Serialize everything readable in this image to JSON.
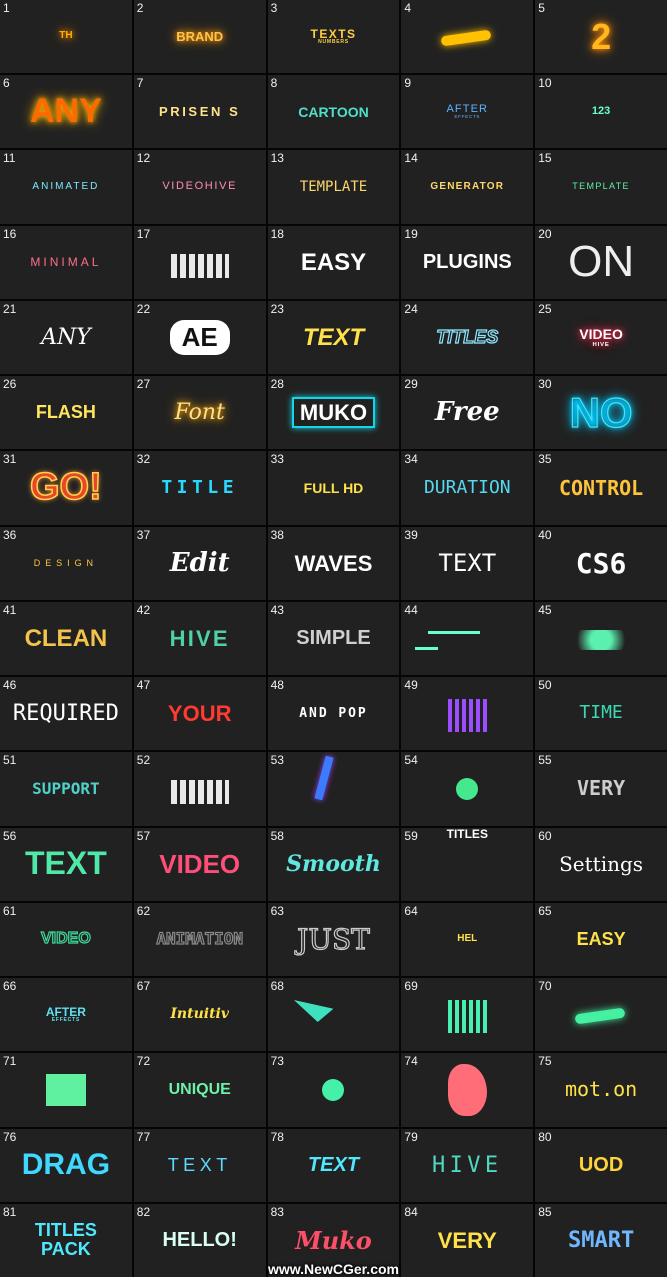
{
  "watermark": "www.NewCGer.com",
  "cells": [
    {
      "n": "1",
      "t": "TH",
      "s": "",
      "c": "#ffb000",
      "sz": 10,
      "f": "sans",
      "w": "bold",
      "g": "#ff8800"
    },
    {
      "n": "2",
      "t": "BRAND",
      "s": "",
      "c": "#ffc34d",
      "sz": 13,
      "f": "sans",
      "w": "bold",
      "g": "#ff9a00"
    },
    {
      "n": "3",
      "t": "TEXTS",
      "s": "NUMBERS",
      "c": "#ffcf40",
      "sz": 12,
      "f": "sans",
      "w": "bold",
      "ls": "0.12em"
    },
    {
      "n": "4",
      "t": "",
      "c": "#ffc100",
      "shape": "stroke"
    },
    {
      "n": "5",
      "t": "2",
      "s": "",
      "c": "#ffb81e",
      "sz": 36,
      "f": "sans",
      "w": "bold",
      "g": "#ff8c00"
    },
    {
      "n": "6",
      "t": "ANY",
      "s": "",
      "c": "#ff6a00",
      "sz": 34,
      "f": "sans",
      "w": "bold",
      "g": "#ffb300"
    },
    {
      "n": "7",
      "t": "PRISEN S",
      "s": "",
      "c": "#ffe28a",
      "sz": 13,
      "f": "sans",
      "w": "bold",
      "ls": "0.2em"
    },
    {
      "n": "8",
      "t": "CARTOON",
      "s": "",
      "c": "#4fe0c8",
      "sz": 14,
      "f": "sans",
      "w": "bold"
    },
    {
      "n": "9",
      "t": "AFTER",
      "s": "EFFECTS",
      "c": "#5fb3ff",
      "sz": 11,
      "f": "sans",
      "w": "normal",
      "ls": "0.1em"
    },
    {
      "n": "10",
      "t": "123",
      "s": "",
      "c": "#66ffd0",
      "sz": 11,
      "f": "sans",
      "w": "bold"
    },
    {
      "n": "11",
      "t": "ANIMATED",
      "s": "",
      "c": "#7ee8ff",
      "sz": 10,
      "f": "sans",
      "w": "normal",
      "ls": "0.2em"
    },
    {
      "n": "12",
      "t": "VIDEOHIVE",
      "s": "",
      "c": "#ff8fb0",
      "sz": 11,
      "f": "sans",
      "w": "normal",
      "ls": "0.15em"
    },
    {
      "n": "13",
      "t": "TEMPLATE",
      "s": "",
      "c": "#ffd86b",
      "sz": 14,
      "f": "mono",
      "w": "normal"
    },
    {
      "n": "14",
      "t": "GENERATOR",
      "s": "",
      "c": "#ffd86b",
      "sz": 10,
      "f": "sans",
      "w": "bold",
      "ls": "0.12em"
    },
    {
      "n": "15",
      "t": "TEMPLATE",
      "s": "",
      "c": "#62f2a8",
      "sz": 9,
      "f": "sans",
      "w": "normal",
      "ls": "0.15em"
    },
    {
      "n": "16",
      "t": "MINIMAL",
      "s": "",
      "c": "#ff6e8a",
      "sz": 12,
      "f": "sans",
      "w": "normal",
      "ls": "0.25em"
    },
    {
      "n": "17",
      "t": "",
      "s": "",
      "c": "#ffffff",
      "shape": "glitch"
    },
    {
      "n": "18",
      "t": "EASY",
      "s": "",
      "c": "#ffffff",
      "sz": 24,
      "f": "sans",
      "w": "bold"
    },
    {
      "n": "19",
      "t": "PLUGINS",
      "s": "",
      "c": "#ffffff",
      "sz": 20,
      "f": "sans",
      "w": "bold"
    },
    {
      "n": "20",
      "t": "ON",
      "s": "",
      "c": "#eeeeee",
      "sz": 44,
      "f": "sans",
      "w": "normal"
    },
    {
      "n": "21",
      "t": "ANY",
      "s": "",
      "c": "#ffffff",
      "sz": 22,
      "f": "serif",
      "w": "normal",
      "it": 1
    },
    {
      "n": "22",
      "t": "AE",
      "s": "",
      "c": "#ffffff",
      "sz": 26,
      "f": "sans",
      "w": "bold",
      "badge": 1
    },
    {
      "n": "23",
      "t": "TEXT",
      "s": "",
      "c": "#ffe14a",
      "sz": 24,
      "f": "sans",
      "w": "bold",
      "it": 1
    },
    {
      "n": "24",
      "t": "TITLES",
      "s": "",
      "c": "#8de7ff",
      "sz": 18,
      "f": "sans",
      "w": "bold",
      "it": 1,
      "outline": 1
    },
    {
      "n": "25",
      "t": "VIDEO",
      "s": "HIVE",
      "c": "#ffffff",
      "sz": 14,
      "f": "sans",
      "w": "bold",
      "g": "#ff2d55"
    },
    {
      "n": "26",
      "t": "FLASH",
      "s": "",
      "c": "#ffe65c",
      "sz": 18,
      "f": "sans",
      "w": "bold"
    },
    {
      "n": "27",
      "t": "Font",
      "s": "",
      "c": "#ffde8a",
      "sz": 22,
      "f": "serif",
      "w": "normal",
      "it": 1,
      "g": "#ffaa00"
    },
    {
      "n": "28",
      "t": "MUKO",
      "s": "",
      "c": "#ffffff",
      "sz": 22,
      "f": "sans",
      "w": "bold",
      "box": "#14d6e8"
    },
    {
      "n": "29",
      "t": "Free",
      "s": "",
      "c": "#ffffff",
      "sz": 26,
      "f": "serif",
      "w": "bold",
      "it": 1
    },
    {
      "n": "30",
      "t": "NO",
      "s": "",
      "c": "#43e6f0",
      "sz": 42,
      "f": "sans",
      "w": "bold",
      "outline": 1,
      "g": "#00c8ff"
    },
    {
      "n": "31",
      "t": "GO!",
      "s": "",
      "c": "#ffd24a",
      "sz": 38,
      "f": "sans",
      "w": "bold",
      "bulb": 1
    },
    {
      "n": "32",
      "t": "TITLE",
      "s": "",
      "c": "#29d8ff",
      "sz": 18,
      "f": "mono",
      "w": "bold",
      "ls": "0.25em"
    },
    {
      "n": "33",
      "t": "FULL HD",
      "s": "",
      "c": "#ffe24a",
      "sz": 14,
      "f": "sans",
      "w": "bold"
    },
    {
      "n": "34",
      "t": "DURATION",
      "s": "",
      "c": "#55d8f0",
      "sz": 18,
      "f": "mono",
      "w": "normal"
    },
    {
      "n": "35",
      "t": "CONTROL",
      "s": "",
      "c": "#ffc23b",
      "sz": 20,
      "f": "mono",
      "w": "bold"
    },
    {
      "n": "36",
      "t": "DESIGN",
      "s": "",
      "c": "#ffc640",
      "sz": 9,
      "f": "sans",
      "w": "normal",
      "ls": "0.55em"
    },
    {
      "n": "37",
      "t": "Edit",
      "s": "",
      "c": "#ffffff",
      "sz": 26,
      "f": "serif",
      "w": "bold",
      "it": 1
    },
    {
      "n": "38",
      "t": "WAVES",
      "s": "",
      "c": "#ffffff",
      "sz": 22,
      "f": "sans",
      "w": "bold"
    },
    {
      "n": "39",
      "t": "TEXT",
      "s": "",
      "c": "#ffffff",
      "sz": 24,
      "f": "mono",
      "w": "normal"
    },
    {
      "n": "40",
      "t": "CS6",
      "s": "",
      "c": "#ffffff",
      "sz": 28,
      "f": "mono",
      "w": "bold"
    },
    {
      "n": "41",
      "t": "CLEAN",
      "s": "",
      "c": "#f4c34a",
      "sz": 24,
      "f": "sans",
      "w": "bold"
    },
    {
      "n": "42",
      "t": "HIVE",
      "s": "",
      "c": "#4fd0a8",
      "sz": 22,
      "f": "sans",
      "w": "bold",
      "ls": "0.1em"
    },
    {
      "n": "43",
      "t": "SIMPLE",
      "s": "",
      "c": "#cfcfcf",
      "sz": 20,
      "f": "sans",
      "w": "bold"
    },
    {
      "n": "44",
      "t": "",
      "s": "",
      "c": "#66ffd0",
      "shape": "dashes"
    },
    {
      "n": "45",
      "t": "",
      "s": "",
      "c": "#5bf0b0",
      "shape": "splash"
    },
    {
      "n": "46",
      "t": "REQUIRED",
      "s": "",
      "c": "#ffffff",
      "sz": 22,
      "f": "mono",
      "w": "normal"
    },
    {
      "n": "47",
      "t": "YOUR",
      "s": "",
      "c": "#ff3b30",
      "sz": 22,
      "f": "sans",
      "w": "bold"
    },
    {
      "n": "48",
      "t": "AND POP",
      "s": "",
      "c": "#ffffff",
      "sz": 13,
      "f": "mono",
      "w": "bold",
      "ls": "0.15em"
    },
    {
      "n": "49",
      "t": "",
      "s": "",
      "c": "#9b4dff",
      "shape": "bars"
    },
    {
      "n": "50",
      "t": "TIME",
      "s": "",
      "c": "#3cd8b0",
      "sz": 18,
      "f": "mono",
      "w": "normal"
    },
    {
      "n": "51",
      "t": "SUPPORT",
      "s": "",
      "c": "#4fd0c8",
      "sz": 16,
      "f": "mono",
      "w": "bold"
    },
    {
      "n": "52",
      "t": "",
      "s": "",
      "c": "#ffffff",
      "shape": "glitch"
    },
    {
      "n": "53",
      "t": "",
      "s": "",
      "c": "#3a7bff",
      "shape": "streak"
    },
    {
      "n": "54",
      "t": "",
      "s": "",
      "c": "#45e88c",
      "shape": "dot"
    },
    {
      "n": "55",
      "t": "VERY",
      "s": "",
      "c": "#cccccc",
      "sz": 20,
      "f": "mono",
      "w": "bold"
    },
    {
      "n": "56",
      "t": "TEXT",
      "s": "",
      "c": "#4fe8a8",
      "sz": 32,
      "f": "sans",
      "w": "bold"
    },
    {
      "n": "57",
      "t": "VIDEO",
      "s": "",
      "c": "#ff4f78",
      "sz": 26,
      "f": "sans",
      "w": "bold"
    },
    {
      "n": "58",
      "t": "Smooth",
      "s": "",
      "c": "#5fe8e0",
      "sz": 22,
      "f": "serif",
      "w": "bold",
      "it": 1
    },
    {
      "n": "59",
      "t": "TITLES",
      "s": "",
      "c": "#ffffff",
      "sz": 12,
      "f": "sans",
      "w": "bold",
      "top": 1
    },
    {
      "n": "60",
      "t": "Settings",
      "s": "",
      "c": "#ffffff",
      "sz": 20,
      "f": "serif",
      "w": "normal"
    },
    {
      "n": "61",
      "t": "VIDEO",
      "s": "",
      "c": "#3fd89a",
      "sz": 16,
      "f": "sans",
      "w": "bold",
      "outline": 1
    },
    {
      "n": "62",
      "t": "ANIMATION",
      "s": "",
      "c": "#888888",
      "sz": 16,
      "f": "mono",
      "w": "bold",
      "outline": 1
    },
    {
      "n": "63",
      "t": "JUST",
      "s": "",
      "c": "#cccccc",
      "sz": 28,
      "f": "serif",
      "w": "normal",
      "outline": 1
    },
    {
      "n": "64",
      "t": "HEL",
      "s": "",
      "c": "#ffe24a",
      "sz": 10,
      "f": "sans",
      "w": "bold"
    },
    {
      "n": "65",
      "t": "EASY",
      "s": "",
      "c": "#ffe24a",
      "sz": 18,
      "f": "sans",
      "w": "bold"
    },
    {
      "n": "66",
      "t": "AFTER",
      "s": "EFFECTS",
      "c": "#5fe0f0",
      "sz": 12,
      "f": "sans",
      "w": "bold"
    },
    {
      "n": "67",
      "t": "Intuitiv",
      "s": "",
      "c": "#ffe24a",
      "sz": 14,
      "f": "serif",
      "w": "bold",
      "it": 1
    },
    {
      "n": "68",
      "t": "",
      "s": "",
      "c": "#3fe0c0",
      "shape": "shards"
    },
    {
      "n": "69",
      "t": "",
      "s": "",
      "c": "#45f0b0",
      "shape": "bars"
    },
    {
      "n": "70",
      "t": "",
      "s": "",
      "c": "#45f0a0",
      "shape": "stroke"
    },
    {
      "n": "71",
      "t": "",
      "s": "",
      "c": "#5ff0a0",
      "shape": "block"
    },
    {
      "n": "72",
      "t": "UNIQUE",
      "s": "",
      "c": "#6ff0a8",
      "sz": 16,
      "f": "sans",
      "w": "bold"
    },
    {
      "n": "73",
      "t": "",
      "s": "",
      "c": "#45f0a8",
      "shape": "dot"
    },
    {
      "n": "74",
      "t": "",
      "s": "",
      "c": "#ff6e78",
      "shape": "splat"
    },
    {
      "n": "75",
      "t": "mot.on",
      "s": "",
      "c": "#ffe24a",
      "sz": 20,
      "f": "mono",
      "w": "normal"
    },
    {
      "n": "76",
      "t": "DRAG",
      "s": "",
      "c": "#3fd8ff",
      "sz": 30,
      "f": "sans",
      "w": "bold"
    },
    {
      "n": "77",
      "t": "TEXT",
      "s": "",
      "c": "#5fd8ff",
      "sz": 18,
      "f": "sans",
      "w": "normal",
      "ls": "0.25em"
    },
    {
      "n": "78",
      "t": "TEXT",
      "s": "",
      "c": "#4fe8ff",
      "sz": 20,
      "f": "sans",
      "w": "bold",
      "it": 1
    },
    {
      "n": "79",
      "t": "HIVE",
      "s": "",
      "c": "#4fd8c0",
      "sz": 22,
      "f": "mono",
      "w": "normal",
      "ls": "0.2em"
    },
    {
      "n": "80",
      "t": "UOD",
      "s": "",
      "c": "#ffd23a",
      "sz": 20,
      "f": "sans",
      "w": "bold"
    },
    {
      "n": "81",
      "t": "TITLES",
      "s": "PACK",
      "c": "#4fe8ff",
      "sz": 18,
      "f": "sans",
      "w": "bold",
      "big": 1
    },
    {
      "n": "82",
      "t": "HELLO!",
      "s": "",
      "c": "#d8fff0",
      "sz": 20,
      "f": "sans",
      "w": "bold"
    },
    {
      "n": "83",
      "t": "Muko",
      "s": "",
      "c": "#ff4f68",
      "sz": 24,
      "f": "serif",
      "w": "bold",
      "it": 1
    },
    {
      "n": "84",
      "t": "VERY",
      "s": "",
      "c": "#ffe24a",
      "sz": 22,
      "f": "sans",
      "w": "bold"
    },
    {
      "n": "85",
      "t": "SMART",
      "s": "",
      "c": "#6fb8ff",
      "sz": 22,
      "f": "mono",
      "w": "bold"
    }
  ]
}
